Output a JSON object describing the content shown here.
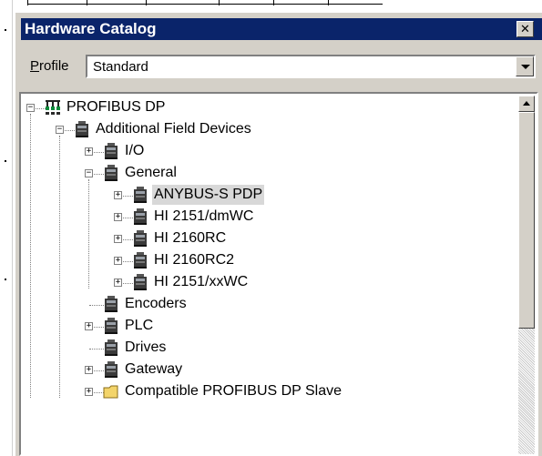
{
  "window": {
    "title": "Hardware Catalog",
    "close_glyph": "✕"
  },
  "profile": {
    "label_mnemonic": "P",
    "label_rest": "rofile",
    "value": "Standard"
  },
  "tree": {
    "nodes": [
      {
        "label": "PROFIBUS DP",
        "icon": "network-icon",
        "expander": "−"
      },
      {
        "label": "Additional Field Devices",
        "icon": "device-icon",
        "expander": "−"
      },
      {
        "label": "I/O",
        "icon": "device-icon",
        "expander": "+"
      },
      {
        "label": "General",
        "icon": "device-icon",
        "expander": "−"
      },
      {
        "label": "ANYBUS-S PDP",
        "icon": "device-icon",
        "expander": "+",
        "selected": true
      },
      {
        "label": "HI 2151/dmWC",
        "icon": "device-icon",
        "expander": "+"
      },
      {
        "label": "HI 2160RC",
        "icon": "device-icon",
        "expander": "+"
      },
      {
        "label": "HI 2160RC2",
        "icon": "device-icon",
        "expander": "+"
      },
      {
        "label": "HI 2151/xxWC",
        "icon": "device-icon",
        "expander": "+"
      },
      {
        "label": "Encoders",
        "icon": "device-icon",
        "expander": ""
      },
      {
        "label": "PLC",
        "icon": "device-icon",
        "expander": "+"
      },
      {
        "label": "Drives",
        "icon": "device-icon",
        "expander": ""
      },
      {
        "label": "Gateway",
        "icon": "device-icon",
        "expander": "+"
      },
      {
        "label": "Compatible PROFIBUS DP Slave",
        "icon": "folder-icon",
        "expander": "+"
      }
    ]
  },
  "colors": {
    "titlebar": "#0a246a",
    "panel": "#d4d0c8",
    "selection": "#d8d8d8"
  }
}
